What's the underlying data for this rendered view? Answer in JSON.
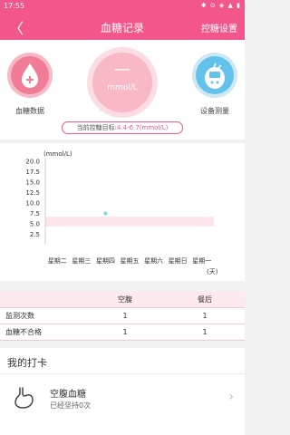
{
  "status": {
    "time": "17:55",
    "right": "✱ ⊙ ◈ ▲ ▮"
  },
  "nav": {
    "back": "〈",
    "title": "血糖记录",
    "settings": "控糖设置"
  },
  "hero": {
    "left_label": "血糖数据",
    "right_label": "设备测量",
    "center_value": "—",
    "center_unit": "mmol/L",
    "goal_prefix": "当前控糖目标:",
    "goal_value": "4.4-6.7(mmol/L)"
  },
  "chart_data": {
    "type": "scatter",
    "ylabel": "(mmol/L)",
    "xlabel": "(天)",
    "ylim": [
      0,
      20
    ],
    "yticks": [
      "20.0",
      "17.5",
      "15.0",
      "12.5",
      "10.0",
      "7.5",
      "5.0",
      "2.5"
    ],
    "categories": [
      "星期二",
      "星期三",
      "星期四",
      "星期五",
      "星期六",
      "星期日",
      "星期一"
    ],
    "target_band": [
      4.4,
      6.7
    ],
    "points": [
      {
        "x": "星期四",
        "y": 7.5
      }
    ],
    "colors": {
      "band": "#fce4ea",
      "point": "#7fd6e0"
    }
  },
  "table": {
    "headers": [
      "",
      "空腹",
      "餐后"
    ],
    "rows": [
      [
        "监测次数",
        "1",
        "1"
      ],
      [
        "血糖不合格",
        "1",
        "1"
      ]
    ]
  },
  "punch": {
    "title": "我的打卡",
    "item_name": "空腹血糖",
    "item_sub": "已经坚持0次",
    "chevron": "›"
  }
}
